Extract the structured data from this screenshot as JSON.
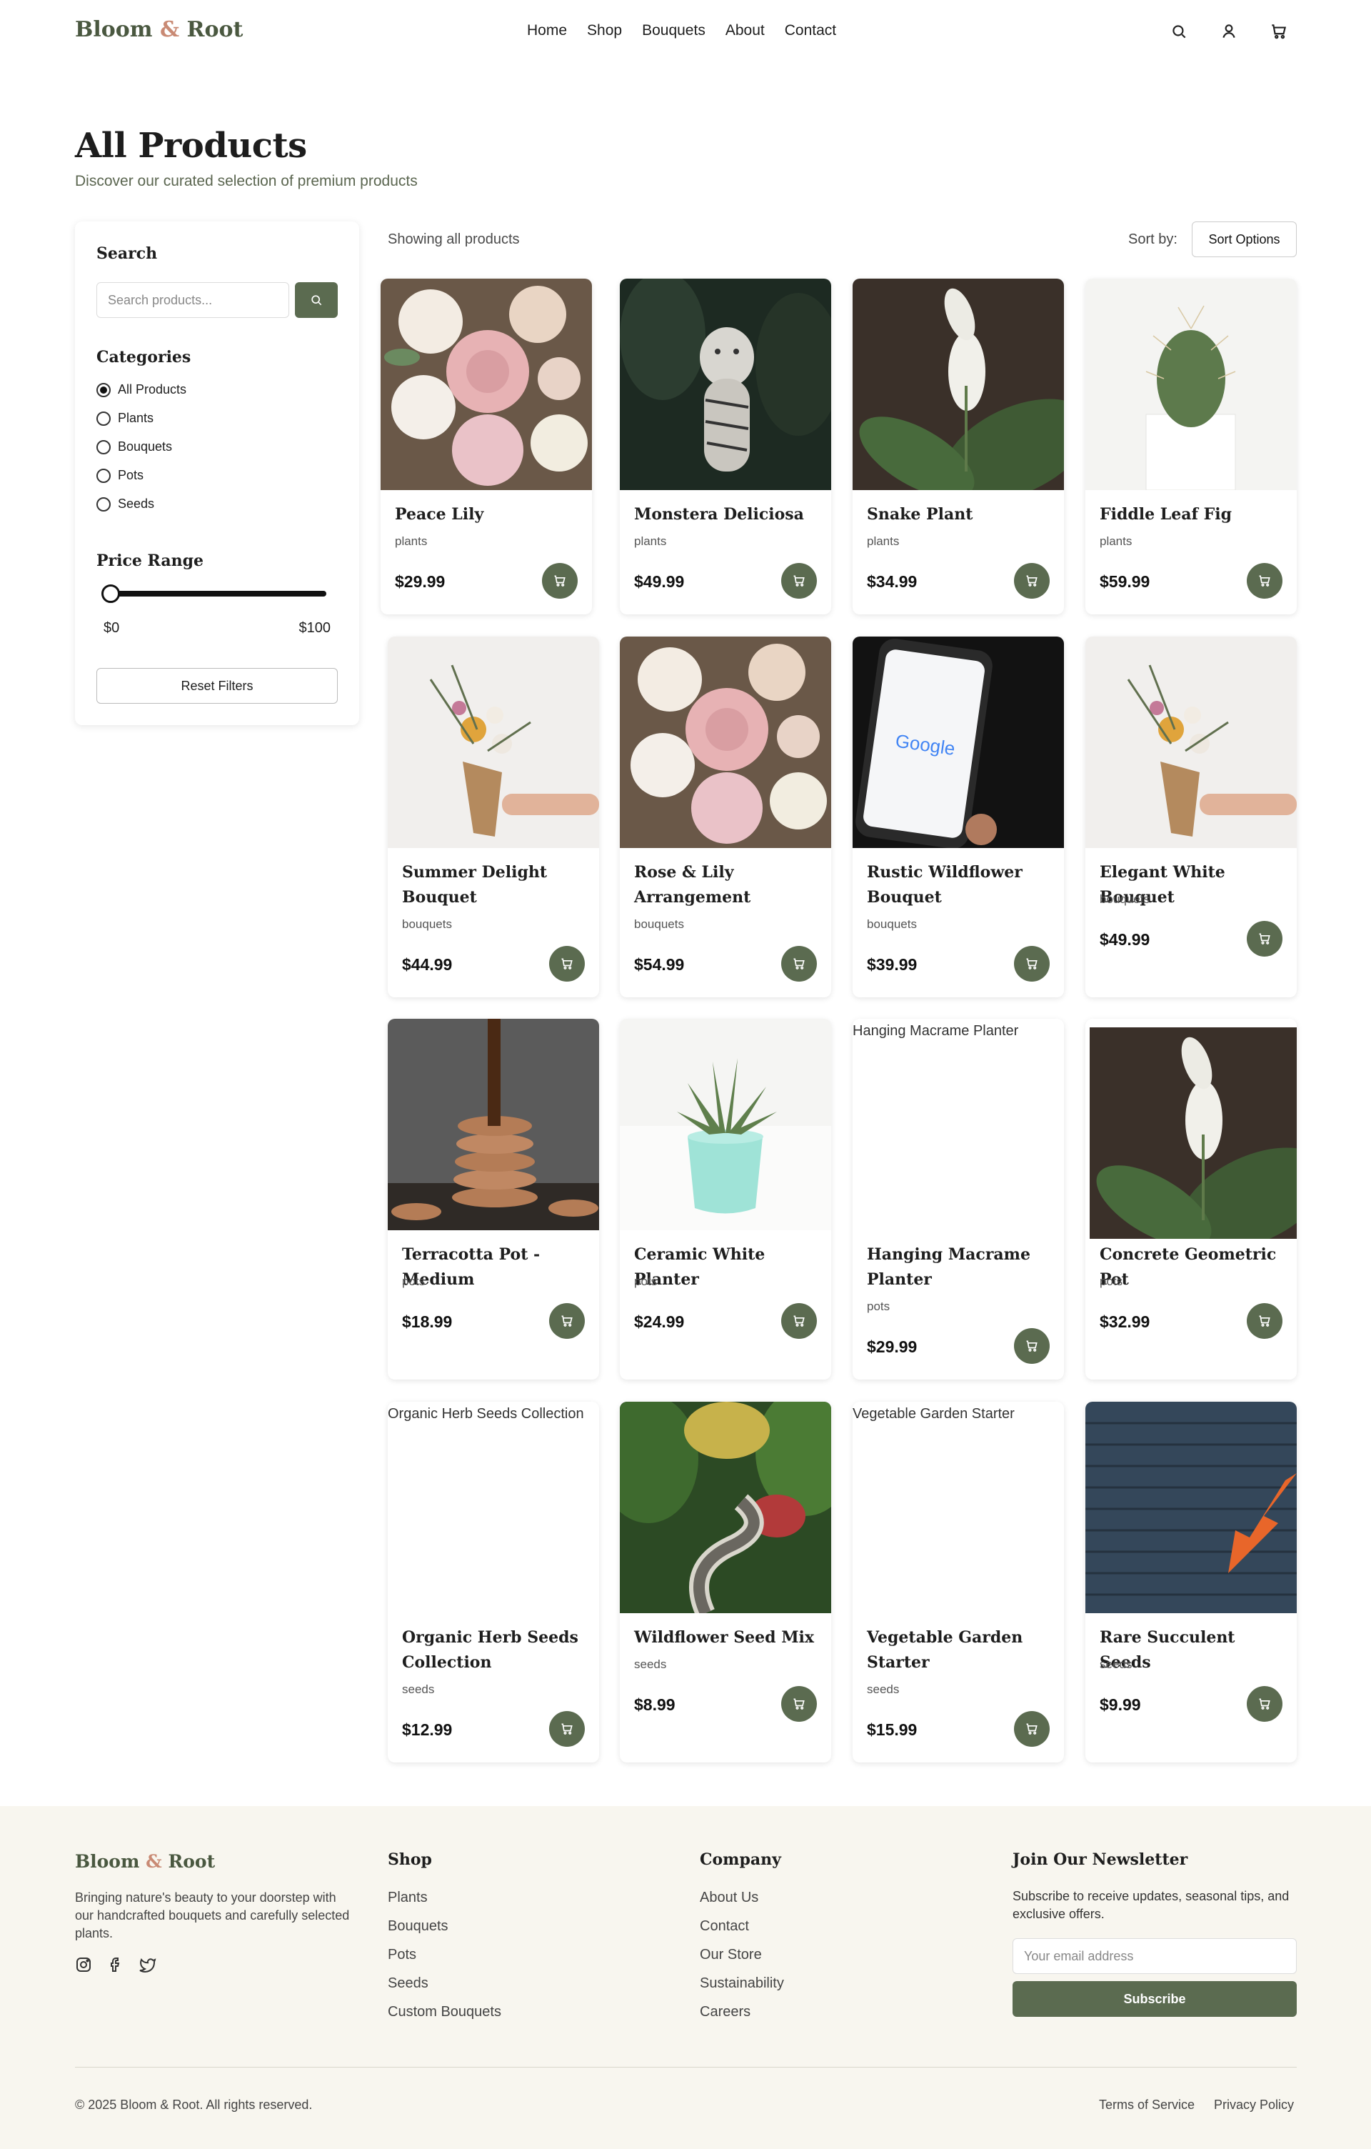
{
  "brand": {
    "name_part1": "Bloom",
    "amp": "&",
    "name_part2": "Root",
    "accent": "#c98a74",
    "primary": "#5b6b50"
  },
  "nav": {
    "items": [
      "Home",
      "Shop",
      "Bouquets",
      "About",
      "Contact"
    ]
  },
  "header_icons": [
    "search-icon",
    "user-icon",
    "cart-icon"
  ],
  "page": {
    "title": "All Products",
    "subtitle": "Discover our curated selection of premium products"
  },
  "sidebar": {
    "search_heading": "Search",
    "search_placeholder": "Search products...",
    "categories_heading": "Categories",
    "categories": [
      "All Products",
      "Plants",
      "Bouquets",
      "Pots",
      "Seeds"
    ],
    "selected_category": "All Products",
    "price_heading": "Price Range",
    "price_min": "$0",
    "price_max": "$100",
    "slider_value_fraction": 0,
    "reset_label": "Reset Filters"
  },
  "toolbar": {
    "showing": "Showing all products",
    "sort_label": "Sort by:",
    "sort_button": "Sort Options"
  },
  "products": [
    {
      "name": "Peace Lily",
      "category": "plants",
      "price": "$29.99"
    },
    {
      "name": "Monstera Deliciosa",
      "category": "plants",
      "price": "$49.99"
    },
    {
      "name": "Snake Plant",
      "category": "plants",
      "price": "$34.99"
    },
    {
      "name": "Fiddle Leaf Fig",
      "category": "plants",
      "price": "$59.99"
    },
    {
      "name": "Summer Delight Bouquet",
      "category": "bouquets",
      "price": "$44.99"
    },
    {
      "name": "Rose & Lily Arrangement",
      "category": "bouquets",
      "price": "$54.99"
    },
    {
      "name": "Rustic Wildflower Bouquet",
      "category": "bouquets",
      "price": "$39.99"
    },
    {
      "name": "Elegant White Bouquet",
      "category": "bouquets",
      "price": "$49.99"
    },
    {
      "name": "Terracotta Pot - Medium",
      "category": "pots",
      "price": "$18.99"
    },
    {
      "name": "Ceramic White Planter",
      "category": "pots",
      "price": "$24.99"
    },
    {
      "name": "Hanging Macrame Planter",
      "category": "pots",
      "price": "$29.99",
      "alt": "Hanging Macrame Planter"
    },
    {
      "name": "Concrete Geometric Pot",
      "category": "pots",
      "price": "$32.99"
    },
    {
      "name": "Organic Herb Seeds Collection",
      "category": "seeds",
      "price": "$12.99",
      "alt": "Organic Herb Seeds Collection"
    },
    {
      "name": "Wildflower Seed Mix",
      "category": "seeds",
      "price": "$8.99"
    },
    {
      "name": "Vegetable Garden Starter",
      "category": "seeds",
      "price": "$15.99",
      "alt": "Vegetable Garden Starter"
    },
    {
      "name": "Rare Succulent Seeds",
      "category": "seeds",
      "price": "$9.99"
    }
  ],
  "footer": {
    "description": "Bringing nature's beauty to your doorstep with our handcrafted bouquets and carefully selected plants.",
    "social": [
      "instagram-icon",
      "facebook-icon",
      "twitter-icon"
    ],
    "shop_heading": "Shop",
    "shop_links": [
      "Plants",
      "Bouquets",
      "Pots",
      "Seeds",
      "Custom Bouquets"
    ],
    "company_heading": "Company",
    "company_links": [
      "About Us",
      "Contact",
      "Our Store",
      "Sustainability",
      "Careers"
    ],
    "newsletter_heading": "Join Our Newsletter",
    "newsletter_desc": "Subscribe to receive updates, seasonal tips, and exclusive offers.",
    "email_placeholder": "Your email address",
    "subscribe_label": "Subscribe",
    "copyright": "© 2025 Bloom & Root. All rights reserved.",
    "legal_links": [
      "Terms of Service",
      "Privacy Policy"
    ]
  }
}
